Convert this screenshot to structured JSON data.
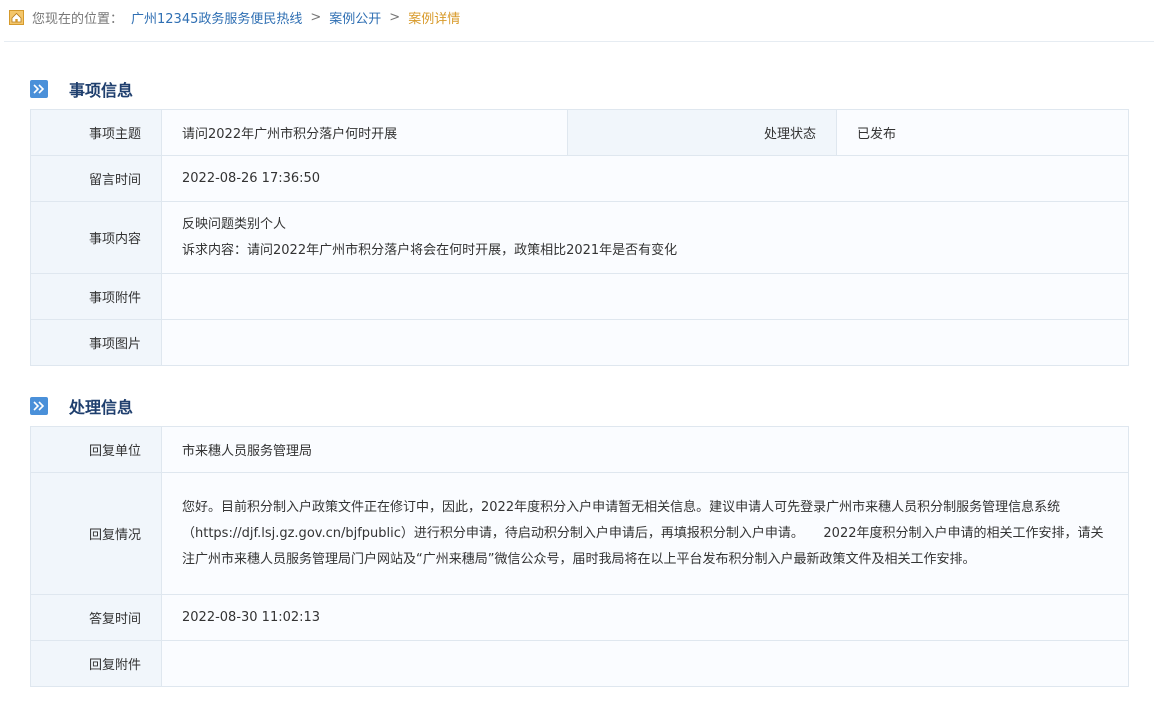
{
  "breadcrumb": {
    "prefix": "您现在的位置：",
    "items": [
      "广州12345政务服务便民热线",
      "案例公开",
      "案例详情"
    ],
    "separator": ">"
  },
  "sections": {
    "matter": {
      "title": "事项信息",
      "subject_label": "事项主题",
      "subject_value": "请问2022年广州市积分落户何时开展",
      "status_label": "处理状态",
      "status_value": "已发布",
      "time_label": "留言时间",
      "time_value": "2022-08-26 17:36:50",
      "content_label": "事项内容",
      "content_line1": "反映问题类别个人",
      "content_line2": "诉求内容：请问2022年广州市积分落户将会在何时开展，政策相比2021年是否有变化",
      "attach_label": "事项附件",
      "attach_value": "",
      "image_label": "事项图片",
      "image_value": ""
    },
    "handling": {
      "title": "处理信息",
      "unit_label": "回复单位",
      "unit_value": "市来穗人员服务管理局",
      "reply_label": "回复情况",
      "reply_value": "您好。目前积分制入户政策文件正在修订中，因此，2022年度积分入户申请暂无相关信息。建议申请人可先登录广州市来穗人员积分制服务管理信息系统（https://djf.lsj.gz.gov.cn/bjfpublic）进行积分申请，待启动积分制入户申请后，再填报积分制入户申请。　　2022年度积分制入户申请的相关工作安排，请关注广州市来穗人员服务管理局门户网站及“广州来穗局”微信公众号，届时我局将在以上平台发布积分制入户最新政策文件及相关工作安排。",
      "answer_time_label": "答复时间",
      "answer_time_value": "2022-08-30 11:02:13",
      "reply_attach_label": "回复附件",
      "reply_attach_value": ""
    }
  },
  "colors": {
    "link": "#2f6fb3",
    "current": "#d89a2a",
    "status": "#e02020",
    "section_title": "#1f3f6e"
  },
  "icons": {
    "home": "home-icon",
    "section": "double-chevron-right-icon"
  }
}
